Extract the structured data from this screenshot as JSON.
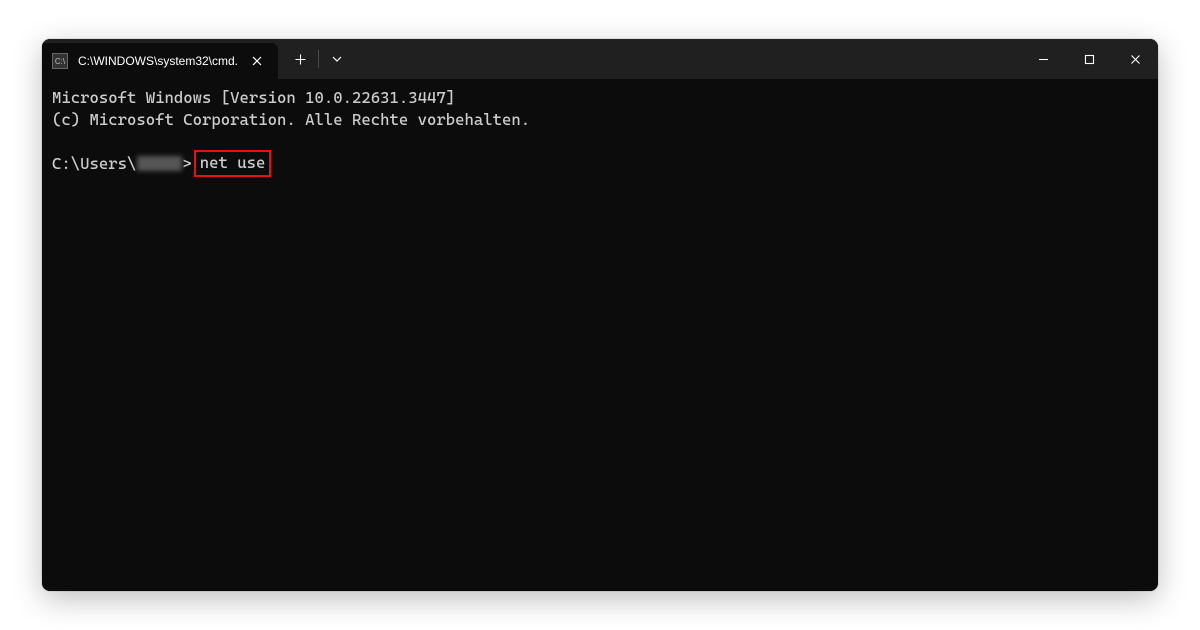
{
  "tab": {
    "title": "C:\\WINDOWS\\system32\\cmd."
  },
  "terminal": {
    "line1": "Microsoft Windows [Version 10.0.22631.3447]",
    "line2": "(c) Microsoft Corporation. Alle Rechte vorbehalten.",
    "prompt_prefix": "C:\\Users\\",
    "prompt_sep": ">",
    "command": "net use"
  }
}
